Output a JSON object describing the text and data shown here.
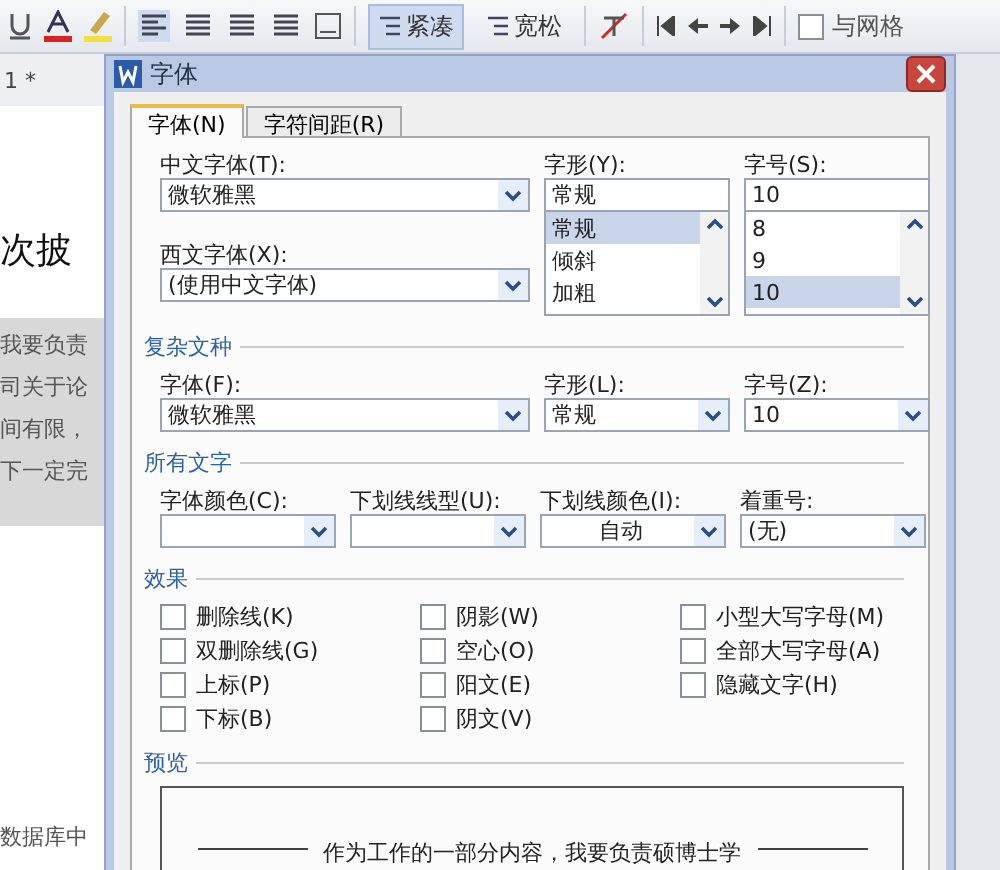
{
  "toolbar": {
    "spacing_buttons": [
      {
        "label": "紧凑",
        "selected": true
      },
      {
        "label": "宽松",
        "selected": false
      }
    ],
    "grid_checkbox": {
      "label": "与网格",
      "checked": false
    }
  },
  "document": {
    "tab_title": "1 *",
    "heading": "次披",
    "lines": [
      "我要负责",
      "司关于论",
      "间有限，",
      "下一定完"
    ],
    "list_item": "数据库中"
  },
  "dialog": {
    "title": "字体",
    "tabs": [
      {
        "label": "字体(N)",
        "selected": true
      },
      {
        "label": "字符间距(R)",
        "selected": false
      }
    ],
    "chinese_font": {
      "label": "中文字体(T):",
      "value": "微软雅黑"
    },
    "style": {
      "label": "字形(Y):",
      "value": "常规",
      "options": [
        {
          "label": "常规",
          "selected": true
        },
        {
          "label": "倾斜",
          "selected": false
        },
        {
          "label": "加粗",
          "selected": false
        }
      ]
    },
    "size": {
      "label": "字号(S):",
      "value": "10",
      "options": [
        {
          "label": "8",
          "selected": false
        },
        {
          "label": "9",
          "selected": false
        },
        {
          "label": "10",
          "selected": true
        }
      ]
    },
    "western_font": {
      "label": "西文字体(X):",
      "value": "(使用中文字体)"
    },
    "complex_section": {
      "title": "复杂文种",
      "fields": [
        {
          "label": "字体(F):",
          "value": "微软雅黑"
        },
        {
          "label": "字形(L):",
          "value": "常规"
        },
        {
          "label": "字号(Z):",
          "value": "10"
        }
      ]
    },
    "all_text_section": {
      "title": "所有文字",
      "fields": [
        {
          "label": "字体颜色(C):"
        },
        {
          "label": "下划线线型(U):"
        },
        {
          "label": "下划线颜色(I):",
          "value": "自动",
          "centered": true
        },
        {
          "label": "着重号:",
          "value": "(无)"
        }
      ]
    },
    "effects_section": {
      "title": "效果",
      "columns": [
        [
          {
            "label": "删除线(K)",
            "checked": false
          },
          {
            "label": "双删除线(G)",
            "checked": false
          },
          {
            "label": "上标(P)",
            "checked": false
          },
          {
            "label": "下标(B)",
            "checked": false
          }
        ],
        [
          {
            "label": "阴影(W)",
            "checked": false
          },
          {
            "label": "空心(O)",
            "checked": false
          },
          {
            "label": "阳文(E)",
            "checked": false
          },
          {
            "label": "阴文(V)",
            "checked": false
          }
        ],
        [
          {
            "label": "小型大写字母(M)",
            "checked": false
          },
          {
            "label": "全部大写字母(A)",
            "checked": false
          },
          {
            "label": "隐藏文字(H)",
            "checked": false
          }
        ]
      ]
    },
    "preview_section": {
      "title": "预览",
      "text": "作为工作的一部分内容，我要负责硕博士学"
    }
  }
}
